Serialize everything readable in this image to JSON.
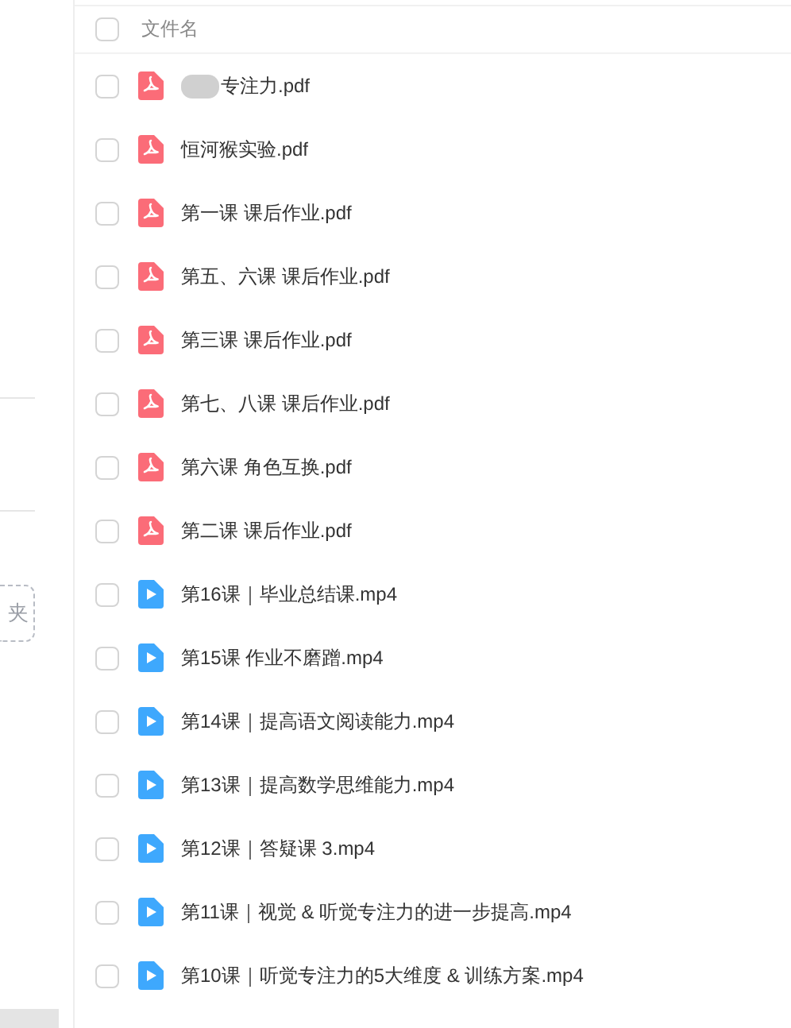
{
  "sidebar": {
    "new_folder_button": {
      "label": "夹"
    }
  },
  "table": {
    "header": {
      "checked": false,
      "label": "文件名"
    },
    "rows": [
      {
        "kind": "pdf",
        "name": "专注力.pdf",
        "redacted": true,
        "checked": false
      },
      {
        "kind": "pdf",
        "name": "恒河猴实验.pdf",
        "redacted": false,
        "checked": false
      },
      {
        "kind": "pdf",
        "name": "第一课 课后作业.pdf",
        "redacted": false,
        "checked": false
      },
      {
        "kind": "pdf",
        "name": "第五、六课 课后作业.pdf",
        "redacted": false,
        "checked": false
      },
      {
        "kind": "pdf",
        "name": "第三课 课后作业.pdf",
        "redacted": false,
        "checked": false
      },
      {
        "kind": "pdf",
        "name": "第七、八课 课后作业.pdf",
        "redacted": false,
        "checked": false
      },
      {
        "kind": "pdf",
        "name": "第六课 角色互换.pdf",
        "redacted": false,
        "checked": false
      },
      {
        "kind": "pdf",
        "name": "第二课 课后作业.pdf",
        "redacted": false,
        "checked": false
      },
      {
        "kind": "video",
        "name": "第16课｜毕业总结课.mp4",
        "redacted": false,
        "checked": false
      },
      {
        "kind": "video",
        "name": "第15课  作业不磨蹭.mp4",
        "redacted": false,
        "checked": false
      },
      {
        "kind": "video",
        "name": "第14课｜提高语文阅读能力.mp4",
        "redacted": false,
        "checked": false
      },
      {
        "kind": "video",
        "name": "第13课｜提高数学思维能力.mp4",
        "redacted": false,
        "checked": false
      },
      {
        "kind": "video",
        "name": "第12课｜答疑课 3.mp4",
        "redacted": false,
        "checked": false
      },
      {
        "kind": "video",
        "name": "第11课｜视觉 & 听觉专注力的进一步提高.mp4",
        "redacted": false,
        "checked": false
      },
      {
        "kind": "video",
        "name": "第10课｜听觉专注力的5大维度 & 训练方案.mp4",
        "redacted": false,
        "checked": false
      }
    ]
  }
}
